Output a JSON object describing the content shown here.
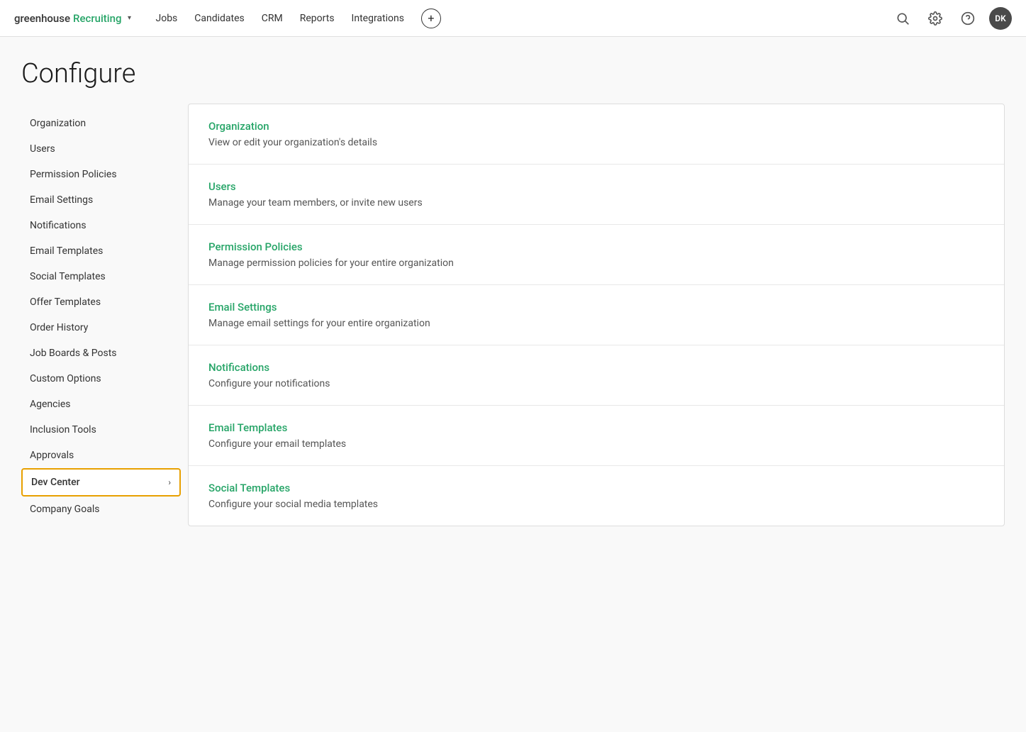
{
  "nav": {
    "logo_greenhouse": "greenhouse",
    "logo_recruiting": "Recruiting",
    "chevron": "▾",
    "links": [
      "Jobs",
      "Candidates",
      "CRM",
      "Reports",
      "Integrations"
    ],
    "plus_label": "+",
    "avatar_initials": "DK"
  },
  "page": {
    "title": "Configure"
  },
  "sidebar": {
    "items": [
      {
        "id": "organization",
        "label": "Organization",
        "active": false,
        "has_chevron": false
      },
      {
        "id": "users",
        "label": "Users",
        "active": false,
        "has_chevron": false
      },
      {
        "id": "permission-policies",
        "label": "Permission Policies",
        "active": false,
        "has_chevron": false
      },
      {
        "id": "email-settings",
        "label": "Email Settings",
        "active": false,
        "has_chevron": false
      },
      {
        "id": "notifications",
        "label": "Notifications",
        "active": false,
        "has_chevron": false
      },
      {
        "id": "email-templates",
        "label": "Email Templates",
        "active": false,
        "has_chevron": false
      },
      {
        "id": "social-templates",
        "label": "Social Templates",
        "active": false,
        "has_chevron": false
      },
      {
        "id": "offer-templates",
        "label": "Offer Templates",
        "active": false,
        "has_chevron": false
      },
      {
        "id": "order-history",
        "label": "Order History",
        "active": false,
        "has_chevron": false
      },
      {
        "id": "job-boards-posts",
        "label": "Job Boards & Posts",
        "active": false,
        "has_chevron": false
      },
      {
        "id": "custom-options",
        "label": "Custom Options",
        "active": false,
        "has_chevron": false
      },
      {
        "id": "agencies",
        "label": "Agencies",
        "active": false,
        "has_chevron": false
      },
      {
        "id": "inclusion-tools",
        "label": "Inclusion Tools",
        "active": false,
        "has_chevron": false
      },
      {
        "id": "approvals",
        "label": "Approvals",
        "active": false,
        "has_chevron": false
      },
      {
        "id": "dev-center",
        "label": "Dev Center",
        "active": true,
        "has_chevron": true
      },
      {
        "id": "company-goals",
        "label": "Company Goals",
        "active": false,
        "has_chevron": false
      }
    ]
  },
  "content": {
    "items": [
      {
        "id": "organization",
        "title": "Organization",
        "description": "View or edit your organization's details"
      },
      {
        "id": "users",
        "title": "Users",
        "description": "Manage your team members, or invite new users"
      },
      {
        "id": "permission-policies",
        "title": "Permission Policies",
        "description": "Manage permission policies for your entire organization"
      },
      {
        "id": "email-settings",
        "title": "Email Settings",
        "description": "Manage email settings for your entire organization"
      },
      {
        "id": "notifications",
        "title": "Notifications",
        "description": "Configure your notifications"
      },
      {
        "id": "email-templates",
        "title": "Email Templates",
        "description": "Configure your email templates"
      },
      {
        "id": "social-templates",
        "title": "Social Templates",
        "description": "Configure your social media templates"
      }
    ]
  }
}
